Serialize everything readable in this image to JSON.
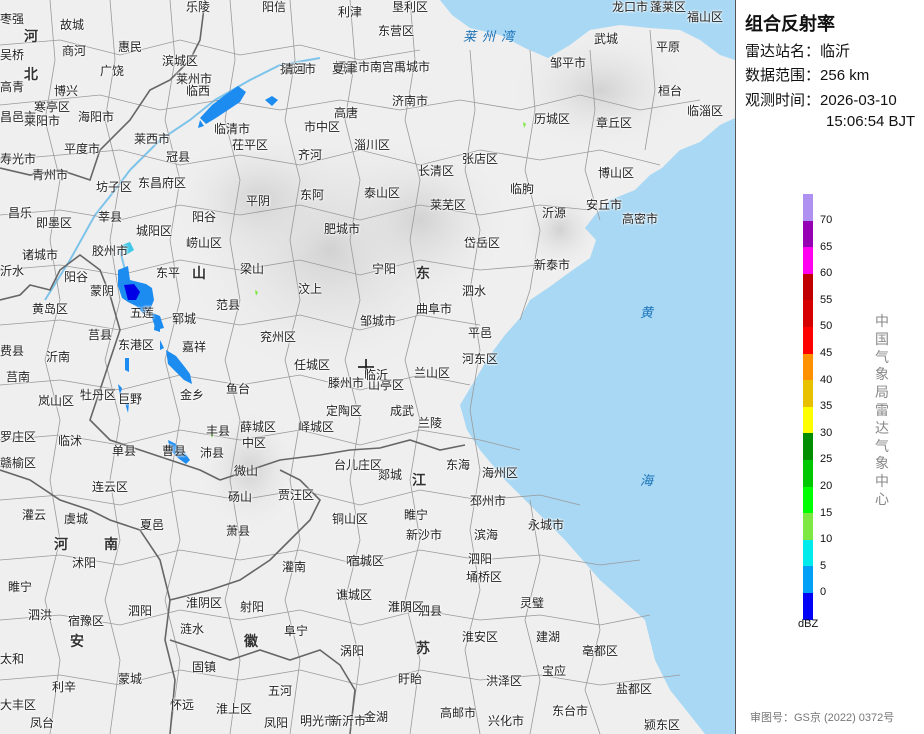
{
  "panel": {
    "title": "组合反射率",
    "station_label": "雷达站名：",
    "station_value": "临沂",
    "range_label": "数据范围：",
    "range_value": "256 km",
    "time_label": "观测时间：",
    "time_date": "2026-03-10",
    "time_clock": "15:06:54 BJT",
    "legend_unit": "dBZ",
    "legend_ticks": [
      "70",
      "65",
      "60",
      "55",
      "50",
      "45",
      "40",
      "35",
      "30",
      "25",
      "20",
      "15",
      "10",
      "5",
      "0"
    ],
    "legend_colors": [
      "#ad90f0",
      "#9600b4",
      "#ff00f0",
      "#c00000",
      "#d60000",
      "#ff0000",
      "#ff9000",
      "#e7c000",
      "#ffff00",
      "#008e00",
      "#00c800",
      "#00ff00",
      "#7ee842",
      "#00ecec",
      "#01a0f6",
      "#0000f6"
    ],
    "vertical_org": "中国气象局雷达气象中心",
    "approval": "审图号：GS京 (2022) 0372号"
  },
  "map": {
    "seas": [
      "莱州湾",
      "黄",
      "海"
    ],
    "provinces": [
      "河",
      "北",
      "山",
      "东",
      "江",
      "苏",
      "河",
      "南",
      "安",
      "徽"
    ],
    "cities": [
      "枣强",
      "故城",
      "乐陵",
      "阳信",
      "利津",
      "垦利区",
      "东营区",
      "龙口市",
      "蓬莱区",
      "福山区",
      "吴桥",
      "商河",
      "惠民",
      "滨城区",
      "招远市",
      "栖霞市",
      "南宫市",
      "武城",
      "平原",
      "高青",
      "博兴",
      "广饶",
      "莱州市",
      "清河",
      "夏津",
      "禹城市",
      "邹平市",
      "桓台",
      "寒亭区",
      "昌邑市",
      "莱阳市",
      "海阳市",
      "临西",
      "临清市",
      "高唐",
      "济南市",
      "历城区",
      "章丘区",
      "临淄区",
      "寿光市",
      "平度市",
      "莱西市",
      "冠县",
      "茌平区",
      "齐河",
      "市中区",
      "淄川区",
      "张店区",
      "青州市",
      "坊子区",
      "东昌府区",
      "东阿",
      "长清区",
      "博山区",
      "昌乐",
      "即墨区",
      "莘县",
      "阳谷",
      "平阴",
      "泰山区",
      "莱芜区",
      "临朐",
      "安丘市",
      "高密市",
      "城阳区",
      "崂山区",
      "肥城市",
      "岱岳区",
      "沂源",
      "诸城市",
      "胶州市",
      "阳谷",
      "东平",
      "梁山",
      "宁阳",
      "新泰市",
      "沂水",
      "黄岛区",
      "范县",
      "汶上",
      "泗水",
      "蒙阴",
      "五莲",
      "郓城",
      "兖州区",
      "曲阜市",
      "平邑",
      "莒县",
      "东港区",
      "嘉祥",
      "任城区",
      "邹城市",
      "费县",
      "沂南",
      "牡丹区",
      "巨野",
      "金乡",
      "鱼台",
      "滕州市",
      "山亭区",
      "兰山区",
      "河东区",
      "莒南",
      "岚山区",
      "定陶区",
      "成武",
      "罗庄区",
      "临沭",
      "单县",
      "丰县",
      "薛城区",
      "中区",
      "峄城区",
      "兰陵",
      "赣榆区",
      "曹县",
      "沛县",
      "微山",
      "台儿庄区",
      "郯城",
      "东海",
      "海州区",
      "连云区",
      "砀山",
      "贾汪区",
      "邳州市",
      "灌云",
      "虞城",
      "夏邑",
      "萧县",
      "铜山区",
      "新沙市",
      "沭阳",
      "灌南",
      "响水",
      "滨海",
      "永城市",
      "睢宁",
      "宿豫区",
      "涟水",
      "射阳",
      "谯城区",
      "濉溪",
      "埇桥区",
      "灵璧",
      "泗洪",
      "泗阳",
      "淮阴区",
      "阜宁",
      "涡阳",
      "泗县",
      "淮安区",
      "建湖",
      "亳都区",
      "太和",
      "利辛",
      "蒙城",
      "固镇",
      "五河",
      "盱眙",
      "洪泽区",
      "宝应",
      "盐都区",
      "大丰区",
      "怀远",
      "淮上区",
      "凤阳",
      "明光市",
      "金湖",
      "高邮市",
      "兴化市",
      "东台市",
      "颍东区",
      "凤台",
      "新沂市",
      "睢宁",
      "宿城区",
      "泗阳",
      "淮阴区",
      "临沂"
    ]
  }
}
